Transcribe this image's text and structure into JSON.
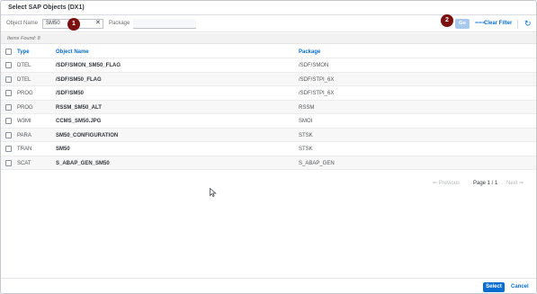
{
  "dialog": {
    "title": "Select SAP Objects (DX1)"
  },
  "filter": {
    "object_name_label": "Object Name",
    "object_name_value": "SM50",
    "package_label": "Package",
    "package_value": "",
    "badge_1": "1",
    "badge_2": "2",
    "go_label": "Go",
    "clear_filter_label": "Clear Filter"
  },
  "items_found": "Items Found: 8",
  "table": {
    "headers": {
      "type": "Type",
      "name": "Object Name",
      "package": "Package"
    },
    "rows": [
      {
        "type": "DTEL",
        "name": "/SDF/SMON_SM50_FLAG",
        "package": "/SDF/SMON"
      },
      {
        "type": "DTEL",
        "name": "/SDF/SM50_FLAG",
        "package": "/SDF/STPI_6X"
      },
      {
        "type": "PROG",
        "name": "/SDF/SM50",
        "package": "/SDF/STPI_6X"
      },
      {
        "type": "PROG",
        "name": "RSSM_SM50_ALT",
        "package": "RSSM"
      },
      {
        "type": "W3MI",
        "name": "CCMS_SM50.JPG",
        "package": "SMOI"
      },
      {
        "type": "PARA",
        "name": "SM50_CONFIGURATION",
        "package": "STSK"
      },
      {
        "type": "TRAN",
        "name": "SM50",
        "package": "STSK"
      },
      {
        "type": "SCAT",
        "name": "S_ABAP_GEN_SM50",
        "package": "S_ABAP_GEN"
      }
    ]
  },
  "pager": {
    "previous": "Previous",
    "page": "Page 1 / 1",
    "next": "Next"
  },
  "footer": {
    "select": "Select",
    "cancel": "Cancel"
  },
  "colors": {
    "accent": "#0a6ed1",
    "badge": "#7a1010",
    "go_disabled": "#a9c9ec"
  }
}
